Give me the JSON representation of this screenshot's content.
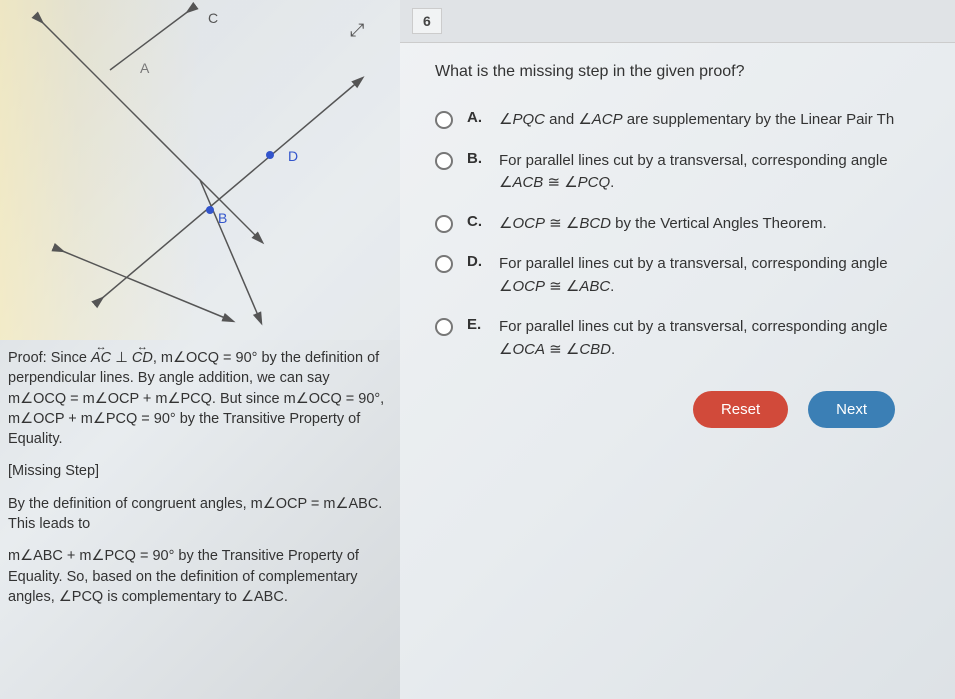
{
  "question_number": "6",
  "question_text": "What is the missing step in the given proof?",
  "diagram": {
    "labels": {
      "C": "C",
      "A": "A",
      "D": "D",
      "B": "B"
    }
  },
  "options": [
    {
      "letter": "A.",
      "text_html": "∠<i>PQC</i> and ∠<i>ACP</i> are supplementary by the Linear Pair Th"
    },
    {
      "letter": "B.",
      "text_html": "For parallel lines cut by a transversal, corresponding angle<br>∠<i>ACB</i> ≅ ∠<i>PCQ</i>."
    },
    {
      "letter": "C.",
      "text_html": "∠<i>OCP</i> ≅ ∠<i>BCD</i> by the Vertical Angles Theorem."
    },
    {
      "letter": "D.",
      "text_html": "For parallel lines cut by a transversal, corresponding angle<br>∠<i>OCP</i> ≅ ∠<i>ABC</i>."
    },
    {
      "letter": "E.",
      "text_html": "For parallel lines cut by a transversal, corresponding angle<br>∠<i>OCA</i> ≅ ∠<i>CBD</i>."
    }
  ],
  "buttons": {
    "reset": "Reset",
    "next": "Next"
  },
  "proof": {
    "p1_html": "Proof: Since&nbsp;<span style='position:relative'><span style='position:absolute;top:-10px;left:0;right:0;text-align:center;font-size:11px'>↔</span><i>AC</i></span>&nbsp;⊥&nbsp;<span style='position:relative'><span style='position:absolute;top:-10px;left:0;right:0;text-align:center;font-size:11px'>↔</span><i>CD</i></span>, m∠OCQ = 90° by the definition of perpendicular lines. By angle addition, we can say m∠OCQ = m∠OCP + m∠PCQ. But since m∠OCQ = 90°, m∠OCP + m∠PCQ = 90° by the Transitive Property of Equality.",
    "p2": "[Missing Step]",
    "p3": "By the definition of congruent angles, m∠OCP = m∠ABC. This leads to",
    "p4": "m∠ABC + m∠PCQ = 90° by the Transitive Property of Equality. So, based on the definition of complementary angles, ∠PCQ is complementary to ∠ABC."
  }
}
